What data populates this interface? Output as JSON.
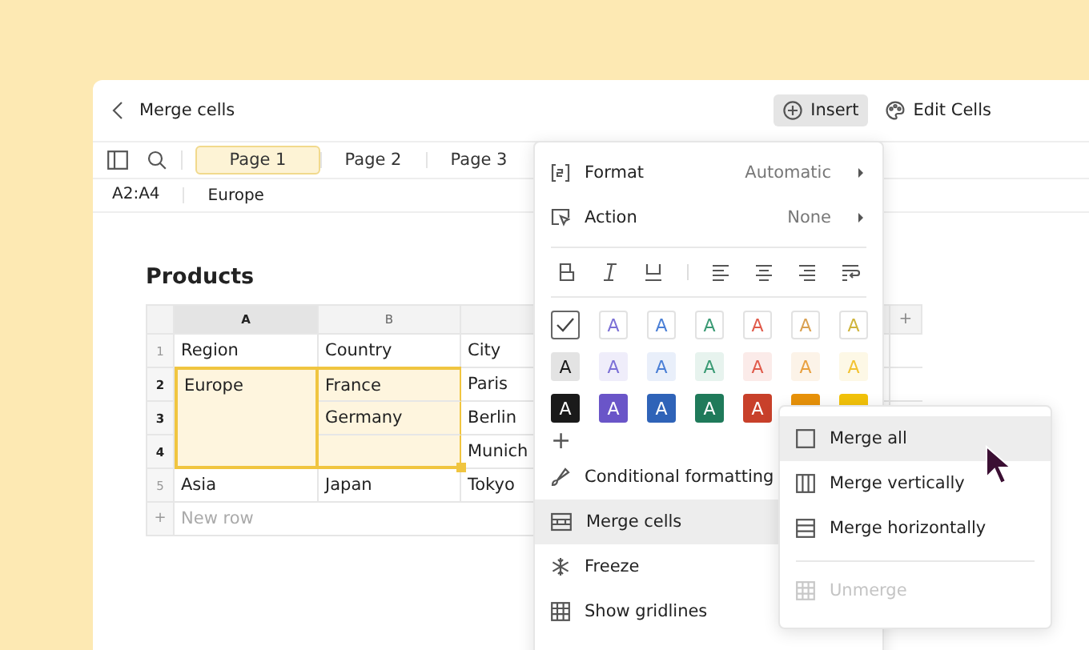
{
  "header": {
    "title": "Merge cells",
    "actions": [
      {
        "label": "Insert",
        "selected": true
      },
      {
        "label": "Edit Cells",
        "selected": false
      }
    ]
  },
  "tabs": [
    {
      "label": "Page 1",
      "selected": true
    },
    {
      "label": "Page 2",
      "selected": false
    },
    {
      "label": "Page 3",
      "selected": false
    }
  ],
  "formula_bar": {
    "reference": "A2:A4",
    "value": "Europe"
  },
  "sheet": {
    "title": "Products",
    "columns": [
      {
        "label": "A",
        "selected": true
      },
      {
        "label": "B",
        "selected": false
      },
      {
        "selected": false
      }
    ],
    "add_column": "+",
    "rows": [
      {
        "number": "1",
        "selected": false,
        "cells": [
          {
            "text": "Region",
            "selected": false,
            "merged": false
          },
          {
            "text": "Country",
            "selected": false,
            "merged": false
          },
          {
            "text": "City",
            "selected": false,
            "merged": false
          }
        ]
      },
      {
        "number": "2",
        "selected": true,
        "cells": [
          {
            "text": "Europe",
            "selected": true,
            "merged": true
          },
          {
            "text": "France",
            "selected": true,
            "merged": false
          },
          {
            "text": "Paris",
            "selected": false,
            "merged": false
          }
        ]
      },
      {
        "number": "3",
        "selected": true,
        "cells": [
          {
            "selected": true,
            "merged": true
          },
          {
            "text": "Germany",
            "selected": true,
            "merged": false
          },
          {
            "text": "Berlin",
            "selected": false,
            "merged": false
          }
        ]
      },
      {
        "number": "4",
        "selected": true,
        "cells": [
          {
            "selected": true,
            "merged": true
          },
          {
            "selected": true,
            "merged": false
          },
          {
            "text": "Munich",
            "selected": false,
            "merged": false
          }
        ]
      },
      {
        "number": "5",
        "selected": false,
        "cells": [
          {
            "text": "Asia",
            "selected": false,
            "merged": false
          },
          {
            "text": "Japan",
            "selected": false,
            "merged": false
          },
          {
            "text": "Tokyo",
            "selected": false,
            "merged": false
          }
        ]
      }
    ],
    "new_row": {
      "icon": "+",
      "placeholder": "New row"
    }
  },
  "menu": {
    "options": [
      {
        "label": "Format",
        "value": "Automatic"
      },
      {
        "label": "Action",
        "value": "None"
      }
    ],
    "palette": [
      {
        "kind": "outline",
        "swatches": [
          {
            "kind": "check",
            "checked": true
          },
          {
            "kind": "letter",
            "label": "A",
            "color": "#7b6fd6"
          },
          {
            "kind": "letter",
            "label": "A",
            "color": "#4a7fd6"
          },
          {
            "kind": "letter",
            "label": "A",
            "color": "#3a9a74"
          },
          {
            "kind": "letter",
            "label": "A",
            "color": "#e05a4a"
          },
          {
            "kind": "letter",
            "label": "A",
            "color": "#d9a050"
          },
          {
            "kind": "letter",
            "label": "A",
            "color": "#cfb43a"
          }
        ]
      },
      {
        "kind": "tint",
        "swatches": [
          {
            "kind": "letter",
            "label": "A",
            "color": "#1a1a1a"
          },
          {
            "kind": "letter",
            "label": "A",
            "color": "#7b6fd6"
          },
          {
            "kind": "letter",
            "label": "A",
            "color": "#4a7fd6"
          },
          {
            "kind": "letter",
            "label": "A",
            "color": "#3a9a74"
          },
          {
            "kind": "letter",
            "label": "A",
            "color": "#e05a4a"
          },
          {
            "kind": "letter",
            "label": "A",
            "color": "#e8a040"
          },
          {
            "kind": "letter",
            "label": "A",
            "color": "#f2c230"
          }
        ]
      },
      {
        "kind": "solid",
        "swatches": [
          {
            "kind": "letter",
            "label": "A",
            "color": "#1a1a1a"
          },
          {
            "kind": "letter",
            "label": "A",
            "color": "#6a55c8"
          },
          {
            "kind": "letter",
            "label": "A",
            "color": "#2f63b8"
          },
          {
            "kind": "letter",
            "label": "A",
            "color": "#1f7a5a"
          },
          {
            "kind": "letter",
            "label": "A",
            "color": "#c8402a"
          },
          {
            "kind": "letter",
            "color": "#e8920a"
          },
          {
            "kind": "letter",
            "color": "#f2c20a"
          }
        ]
      }
    ],
    "add_color": "+",
    "actions": [
      {
        "label": "Conditional formatting",
        "selected": false
      },
      {
        "label": "Merge cells",
        "selected": true
      },
      {
        "label": "Freeze",
        "selected": false
      },
      {
        "label": "Show gridlines",
        "selected": false
      }
    ]
  },
  "submenu": {
    "items": [
      {
        "label": "Merge all",
        "selected": true,
        "disabled": false
      },
      {
        "label": "Merge vertically",
        "selected": false,
        "disabled": false
      },
      {
        "label": "Merge horizontally",
        "selected": false,
        "disabled": false
      },
      {
        "label": "Unmerge",
        "selected": false,
        "disabled": true
      }
    ]
  }
}
